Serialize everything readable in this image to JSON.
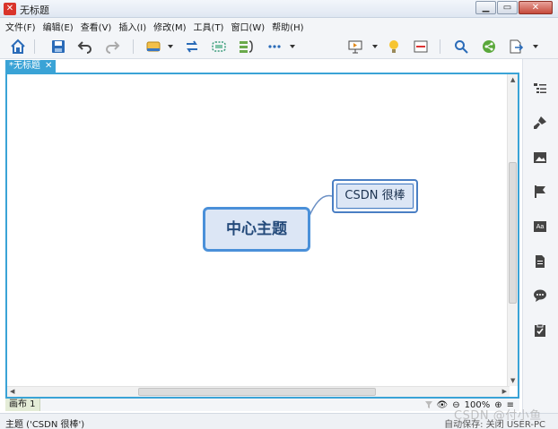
{
  "window": {
    "title": "无标题"
  },
  "menu": [
    "文件(F)",
    "编辑(E)",
    "查看(V)",
    "插入(I)",
    "修改(M)",
    "工具(T)",
    "窗口(W)",
    "帮助(H)"
  ],
  "toolbar": {
    "icons": [
      "home-icon",
      "save-icon",
      "undo-icon",
      "redo-icon",
      "topic-style-icon",
      "relationship-icon",
      "boundary-icon",
      "summary-icon",
      "more-icon",
      "presentation-icon",
      "idea-icon",
      "outline-icon",
      "search-icon",
      "share-icon",
      "export-icon"
    ]
  },
  "document_tab": {
    "label": "*无标题",
    "close": "✕"
  },
  "mindmap": {
    "central_topic": "中心主题",
    "subtopic": "CSDN 很棒"
  },
  "sheet_tab": "画布 1",
  "zoom": {
    "minus": "⊖",
    "value": "100%",
    "plus": "⊕"
  },
  "status": {
    "left": "主题 ('CSDN 很棒')",
    "right": "自动保存: 关闭   USER-PC"
  },
  "watermark": "CSDN @付小鱼",
  "side_panel": [
    "outline-panel-icon",
    "format-brush-icon",
    "image-icon",
    "flag-icon",
    "text-format-icon",
    "notes-icon",
    "comment-icon",
    "task-icon"
  ],
  "colors": {
    "accent": "#3aa3d6",
    "topic_fill": "#dce6f5",
    "topic_border": "#4a90d9",
    "topic_text": "#244a7a"
  }
}
